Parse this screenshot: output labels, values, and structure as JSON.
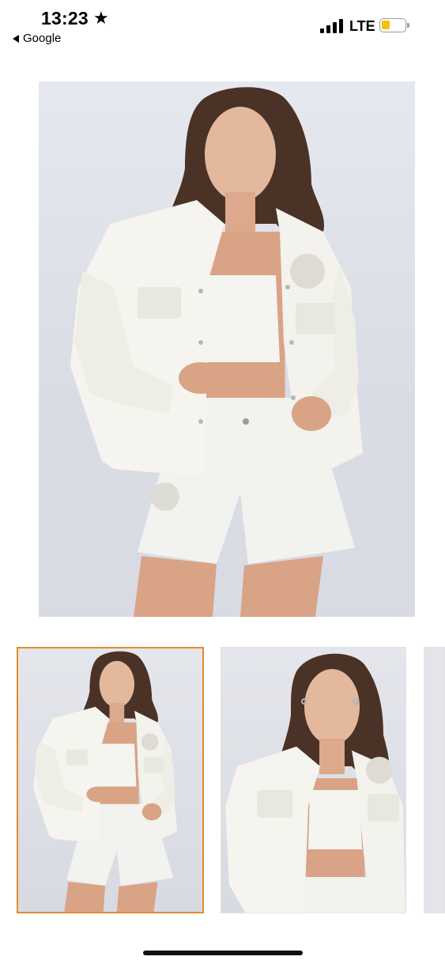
{
  "status_bar": {
    "time": "13:23",
    "back_label": "Google",
    "network": "LTE",
    "icons": [
      "star-icon",
      "back-arrow-icon",
      "signal-icon",
      "battery-icon"
    ],
    "battery_level": 0.4,
    "battery_color": "#f4c20d"
  },
  "gallery": {
    "selected_index": 0,
    "selected_border_color": "#e58a2e",
    "images": [
      "main-product-image",
      "thumbnail-1",
      "thumbnail-2",
      "thumbnail-3"
    ]
  }
}
